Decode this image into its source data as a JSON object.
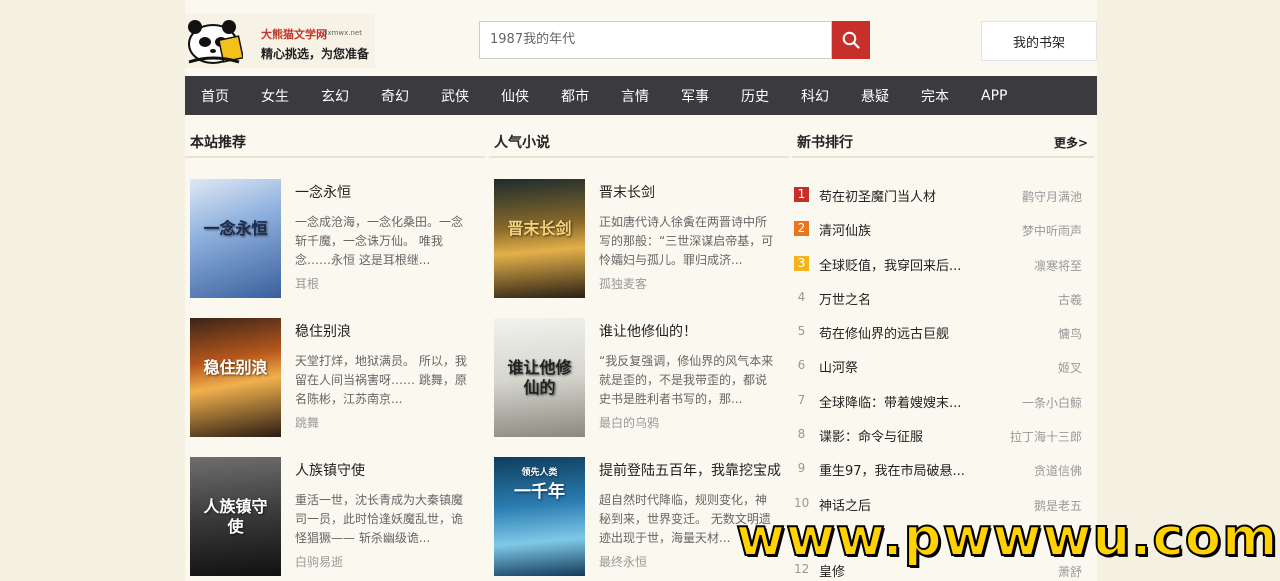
{
  "header": {
    "site_name": "大熊猫文学网",
    "site_domain": "dxmwx.net",
    "slogan": "精心挑选，为您准备",
    "search_placeholder": "1987我的年代",
    "search_icon": "search-icon",
    "shelf_label": "我的书架"
  },
  "nav": {
    "items": [
      "首页",
      "女生",
      "玄幻",
      "奇幻",
      "武侠",
      "仙侠",
      "都市",
      "言情",
      "军事",
      "历史",
      "科幻",
      "悬疑",
      "完本",
      "APP"
    ]
  },
  "recommend": {
    "title": "本站推荐",
    "books": [
      {
        "name": "一念永恒",
        "desc": "一念成沧海，一念化桑田。一念斩千魔，一念诛万仙。 唯我念……永恒 这是耳根继...",
        "author": "耳根",
        "cover_text": "一念永恒"
      },
      {
        "name": "稳住别浪",
        "desc": "天堂打烊，地狱满员。 所以，我留在人间当祸害呀…… 跳舞，原名陈彬，江苏南京...",
        "author": "跳舞",
        "cover_text": "稳住别浪"
      },
      {
        "name": "人族镇守使",
        "desc": "重活一世，沈长青成为大秦镇魔司一员，此时恰逢妖魔乱世，诡怪猖獗—— 斩杀幽级诡...",
        "author": "白驹易逝",
        "cover_text": "人族镇守使"
      }
    ]
  },
  "popular": {
    "title": "人气小说",
    "books": [
      {
        "name": "晋末长剑",
        "desc": "正如唐代诗人徐夤在两晋诗中所写的那般：“三世深谋启帝基，可怜孀妇与孤儿。罪归成济...",
        "author": "孤独麦客",
        "cover_text": "晋末长剑"
      },
      {
        "name": "谁让他修仙的！",
        "desc": "“我反复强调，修仙界的风气本来就是歪的，不是我带歪的，都说史书是胜利者书写的，那...",
        "author": "最白的乌鸦",
        "cover_text": "谁让他修仙的"
      },
      {
        "name": "提前登陆五百年，我靠挖宝成",
        "desc": "超自然时代降临，规则变化，神秘到来，世界变迁。 无数文明遗迹出现于世，海量天材...",
        "author": "最终永恒",
        "cover_text": "一千年",
        "cover_sub": "领先人类"
      }
    ]
  },
  "ranking": {
    "title": "新书排行",
    "more_label": "更多>",
    "items": [
      {
        "num": "1",
        "name": "苟在初圣魔门当人材",
        "author": "鹳守月满池",
        "color": "#c7302a"
      },
      {
        "num": "2",
        "name": "清河仙族",
        "author": "梦中听雨声",
        "color": "#e8761c"
      },
      {
        "num": "3",
        "name": "全球贬值，我穿回来后...",
        "author": "凛寒将至",
        "color": "#f2b51c"
      },
      {
        "num": "4",
        "name": "万世之名",
        "author": "古羲",
        "color": ""
      },
      {
        "num": "5",
        "name": "苟在修仙界的远古巨舰",
        "author": "慵鸟",
        "color": ""
      },
      {
        "num": "6",
        "name": "山河祭",
        "author": "姬叉",
        "color": ""
      },
      {
        "num": "7",
        "name": "全球降临：带着嫂嫂末...",
        "author": "一条小白鲸",
        "color": ""
      },
      {
        "num": "8",
        "name": "谍影：命令与征服",
        "author": "拉丁海十三郎",
        "color": ""
      },
      {
        "num": "9",
        "name": "重生97，我在市局破悬...",
        "author": "贪道信佛",
        "color": ""
      },
      {
        "num": "10",
        "name": "神话之后",
        "author": "鹅是老五",
        "color": ""
      },
      {
        "num": "12",
        "name": "皇修",
        "author": "萧舒",
        "color": ""
      }
    ]
  },
  "watermark": "www.pwwwu.com"
}
